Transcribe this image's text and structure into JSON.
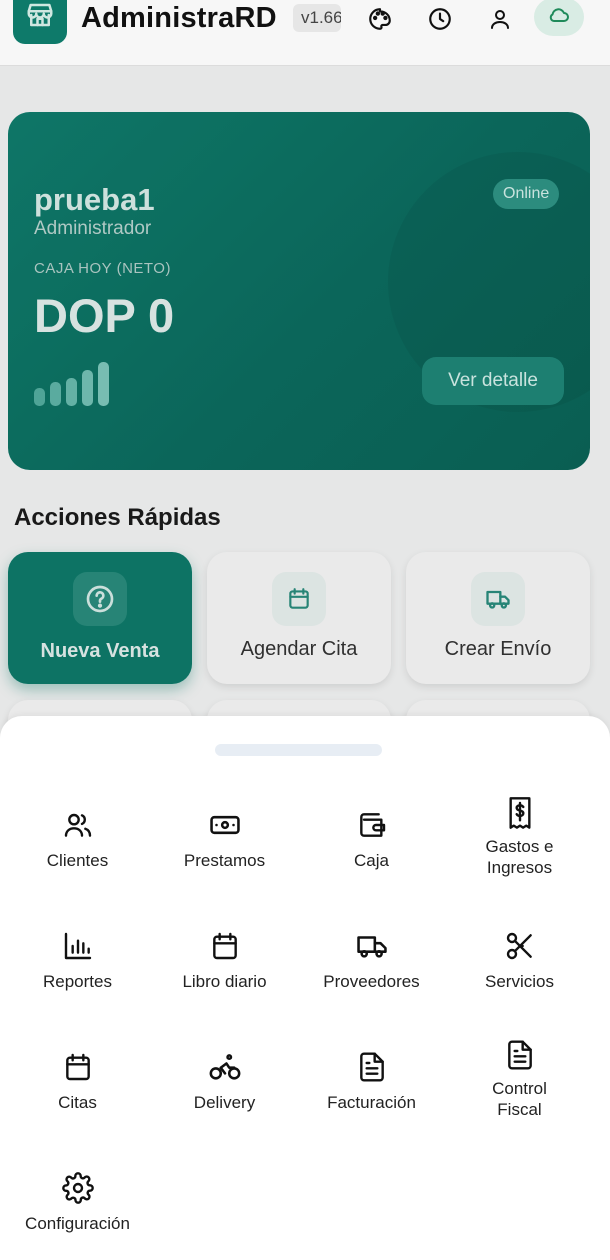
{
  "header": {
    "title": "AdministraRD",
    "version": "v1.66",
    "icons": [
      "store-icon",
      "palette-icon",
      "clock-icon",
      "user-icon",
      "cloud-icon"
    ]
  },
  "card": {
    "user_name": "prueba1",
    "role": "Administrador",
    "status": "Online",
    "caja_label": "CAJA HOY (NETO)",
    "caja_amount": "DOP 0",
    "detail_button": "Ver detalle"
  },
  "quick_actions": {
    "title": "Acciones Rápidas",
    "items": [
      {
        "label": "Nueva Venta",
        "icon": "question-icon"
      },
      {
        "label": "Agendar Cita",
        "icon": "calendar-icon"
      },
      {
        "label": "Crear Envío",
        "icon": "truck-icon"
      }
    ]
  },
  "menu": {
    "items": [
      {
        "label": "Clientes",
        "icon": "users-icon"
      },
      {
        "label": "Prestamos",
        "icon": "banknote-icon"
      },
      {
        "label": "Caja",
        "icon": "wallet-icon"
      },
      {
        "label": "Gastos e\nIngresos",
        "icon": "receipt-icon"
      },
      {
        "label": "Reportes",
        "icon": "bar-chart-icon"
      },
      {
        "label": "Libro diario",
        "icon": "calendar-icon"
      },
      {
        "label": "Proveedores",
        "icon": "truck-icon"
      },
      {
        "label": "Servicios",
        "icon": "scissors-icon"
      },
      {
        "label": "Citas",
        "icon": "calendar-icon"
      },
      {
        "label": "Delivery",
        "icon": "bike-icon"
      },
      {
        "label": "Facturación",
        "icon": "file-text-icon"
      },
      {
        "label": "Control\nFiscal",
        "icon": "file-text-icon"
      },
      {
        "label": "Configuración",
        "icon": "gear-icon"
      }
    ]
  },
  "colors": {
    "brand": "#0e7a6a",
    "sheet_bg": "#ffffff",
    "page_bg": "#f3f4f4"
  }
}
